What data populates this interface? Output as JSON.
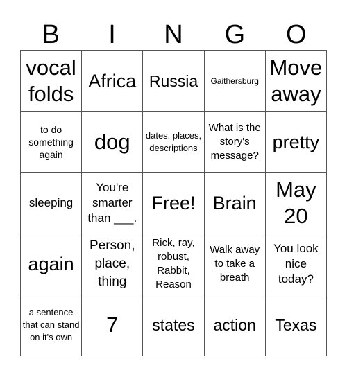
{
  "header": {
    "letters": [
      "B",
      "I",
      "N",
      "G",
      "O"
    ]
  },
  "cells": [
    [
      "vocal folds",
      "Africa",
      "Russia",
      "Gaithersburg",
      "Move away"
    ],
    [
      "to do something again",
      "dog",
      "dates, places, descriptions",
      "What is the story's message?",
      "pretty"
    ],
    [
      "sleeping",
      "You're smarter than ___.",
      "Free!",
      "Brain",
      "May 20"
    ],
    [
      "again",
      "Person, place, thing",
      "Rick, ray, robust, Rabbit, Reason",
      "Walk away to take a breath",
      "You look nice today?"
    ],
    [
      "a sentence that can stand on it's own",
      "7",
      "states",
      "action",
      "Texas"
    ]
  ]
}
